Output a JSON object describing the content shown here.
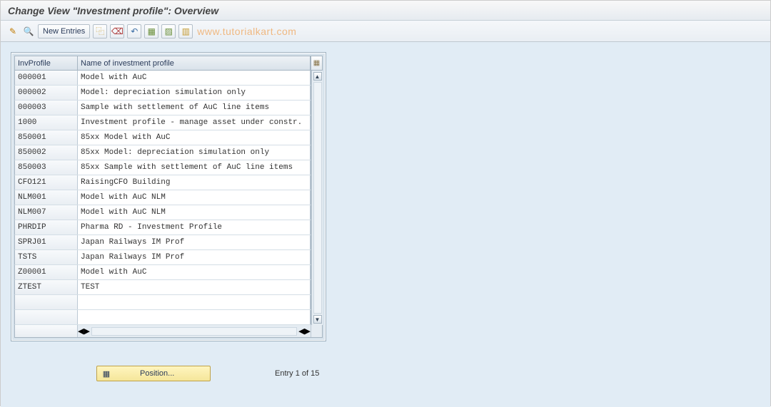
{
  "title": "Change View \"Investment profile\": Overview",
  "toolbar": {
    "new_entries_label": "New Entries"
  },
  "watermark": "www.tutorialkart.com",
  "columns": {
    "left_header": "InvProfile",
    "right_header": "Name of investment profile"
  },
  "rows": [
    {
      "id": "000001",
      "name": "Model with AuC"
    },
    {
      "id": "000002",
      "name": "Model: depreciation simulation only"
    },
    {
      "id": "000003",
      "name": "Sample with settlement of AuC line items"
    },
    {
      "id": "1000",
      "name": "Investment profile - manage asset under constr."
    },
    {
      "id": "850001",
      "name": "85xx Model with AuC"
    },
    {
      "id": "850002",
      "name": "85xx Model: depreciation simulation only"
    },
    {
      "id": "850003",
      "name": "85xx Sample with settlement of AuC line items"
    },
    {
      "id": "CFO121",
      "name": "RaisingCFO Building"
    },
    {
      "id": "NLM001",
      "name": "Model with AuC NLM"
    },
    {
      "id": "NLM007",
      "name": "Model with AuC NLM"
    },
    {
      "id": "PHRDIP",
      "name": "Pharma RD - Investment Profile"
    },
    {
      "id": "SPRJ01",
      "name": "Japan Railways IM Prof"
    },
    {
      "id": "TSTS",
      "name": "Japan Railways IM Prof"
    },
    {
      "id": "Z00001",
      "name": "Model with AuC"
    },
    {
      "id": "ZTEST",
      "name": "TEST"
    },
    {
      "id": "",
      "name": ""
    },
    {
      "id": "",
      "name": ""
    }
  ],
  "footer": {
    "position_label": "Position...",
    "entry_info": "Entry 1 of 15"
  }
}
